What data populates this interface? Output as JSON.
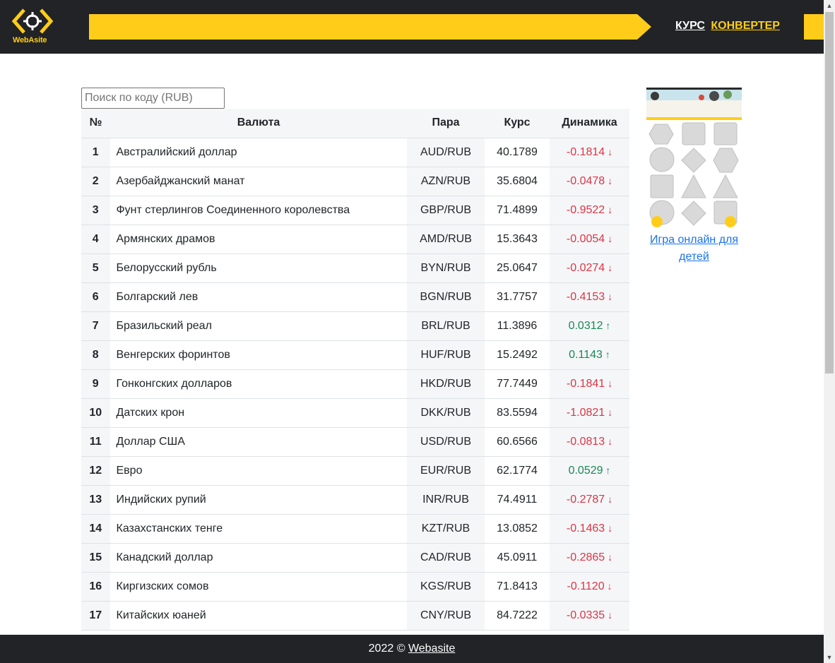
{
  "header": {
    "logo_text": "WebAsite",
    "nav": {
      "course": "КУРС",
      "converter": "КОНВЕРТЕР"
    }
  },
  "search": {
    "placeholder": "Поиск по коду (RUB)",
    "value": ""
  },
  "table": {
    "headers": {
      "num": "№",
      "name": "Валюта",
      "pair": "Пара",
      "rate": "Курс",
      "dynamics": "Динамика"
    },
    "rows": [
      {
        "num": "1",
        "name": "Австралийский доллар",
        "pair": "AUD/RUB",
        "rate": "40.1789",
        "dynamics": "-0.1814",
        "trend": "down"
      },
      {
        "num": "2",
        "name": "Азербайджанский манат",
        "pair": "AZN/RUB",
        "rate": "35.6804",
        "dynamics": "-0.0478",
        "trend": "down"
      },
      {
        "num": "3",
        "name": "Фунт стерлингов Соединенного королевства",
        "pair": "GBP/RUB",
        "rate": "71.4899",
        "dynamics": "-0.9522",
        "trend": "down"
      },
      {
        "num": "4",
        "name": "Армянских драмов",
        "pair": "AMD/RUB",
        "rate": "15.3643",
        "dynamics": "-0.0054",
        "trend": "down"
      },
      {
        "num": "5",
        "name": "Белорусский рубль",
        "pair": "BYN/RUB",
        "rate": "25.0647",
        "dynamics": "-0.0274",
        "trend": "down"
      },
      {
        "num": "6",
        "name": "Болгарский лев",
        "pair": "BGN/RUB",
        "rate": "31.7757",
        "dynamics": "-0.4153",
        "trend": "down"
      },
      {
        "num": "7",
        "name": "Бразильский реал",
        "pair": "BRL/RUB",
        "rate": "11.3896",
        "dynamics": "0.0312",
        "trend": "up"
      },
      {
        "num": "8",
        "name": "Венгерских форинтов",
        "pair": "HUF/RUB",
        "rate": "15.2492",
        "dynamics": "0.1143",
        "trend": "up"
      },
      {
        "num": "9",
        "name": "Гонконгских долларов",
        "pair": "HKD/RUB",
        "rate": "77.7449",
        "dynamics": "-0.1841",
        "trend": "down"
      },
      {
        "num": "10",
        "name": "Датских крон",
        "pair": "DKK/RUB",
        "rate": "83.5594",
        "dynamics": "-1.0821",
        "trend": "down"
      },
      {
        "num": "11",
        "name": "Доллар США",
        "pair": "USD/RUB",
        "rate": "60.6566",
        "dynamics": "-0.0813",
        "trend": "down"
      },
      {
        "num": "12",
        "name": "Евро",
        "pair": "EUR/RUB",
        "rate": "62.1774",
        "dynamics": "0.0529",
        "trend": "up"
      },
      {
        "num": "13",
        "name": "Индийских рупий",
        "pair": "INR/RUB",
        "rate": "74.4911",
        "dynamics": "-0.2787",
        "trend": "down"
      },
      {
        "num": "14",
        "name": "Казахстанских тенге",
        "pair": "KZT/RUB",
        "rate": "13.0852",
        "dynamics": "-0.1463",
        "trend": "down"
      },
      {
        "num": "15",
        "name": "Канадский доллар",
        "pair": "CAD/RUB",
        "rate": "45.0911",
        "dynamics": "-0.2865",
        "trend": "down"
      },
      {
        "num": "16",
        "name": "Киргизских сомов",
        "pair": "KGS/RUB",
        "rate": "71.8413",
        "dynamics": "-0.1120",
        "trend": "down"
      },
      {
        "num": "17",
        "name": "Китайских юаней",
        "pair": "CNY/RUB",
        "rate": "84.7222",
        "dynamics": "-0.0335",
        "trend": "down"
      }
    ]
  },
  "ad": {
    "link_text": "Игра онлайн для детей"
  },
  "footer": {
    "prefix": "2022 ©",
    "link": "Webasite"
  },
  "colors": {
    "accent": "#ffcd19",
    "header_bg": "#212326",
    "down": "#dc3545",
    "up": "#198754"
  },
  "icons": {
    "down_arrow": "arrow-down-icon",
    "up_arrow": "arrow-up-icon"
  }
}
